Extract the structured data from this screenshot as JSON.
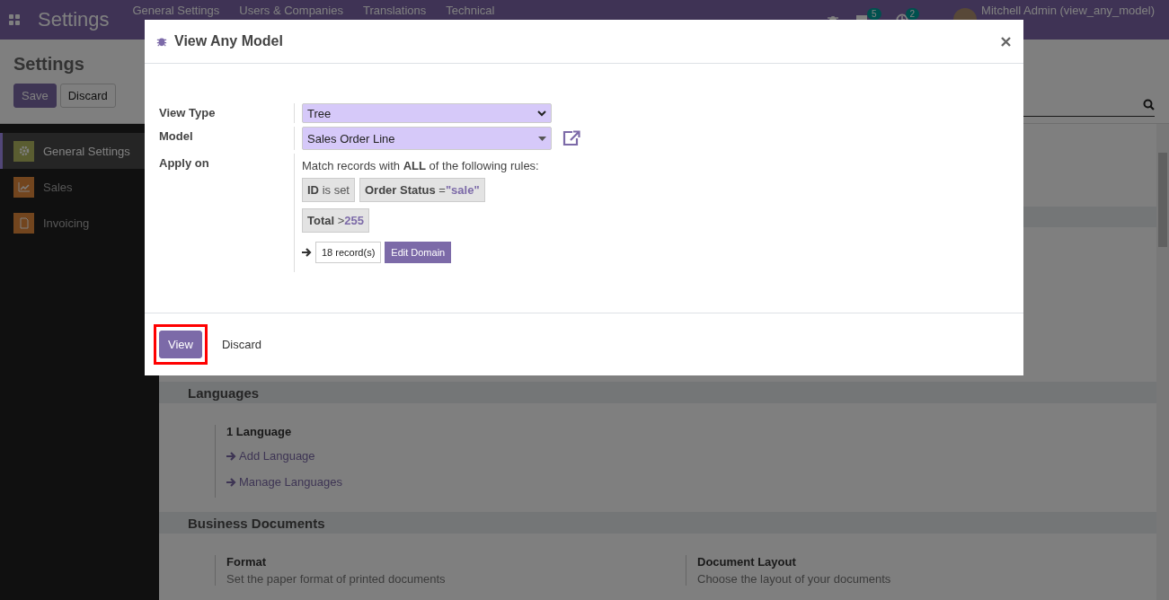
{
  "navbar": {
    "app_title": "Settings",
    "menu": [
      "General Settings",
      "Users & Companies",
      "Translations",
      "Technical"
    ],
    "chat_count": "5",
    "activity_count": "2",
    "user": "Mitchell Admin (view_any_model)"
  },
  "control_panel": {
    "breadcrumb": "Settings",
    "buttons": [
      {
        "label": "Save",
        "kind": "primary"
      },
      {
        "label": "Discard",
        "kind": "secondary"
      }
    ]
  },
  "sidebar": {
    "items": [
      {
        "label": "General Settings",
        "selected": true
      },
      {
        "label": "Sales",
        "selected": false
      },
      {
        "label": "Invoicing",
        "selected": false
      }
    ]
  },
  "sections": [
    {
      "title": "Languages",
      "blocks": [
        {
          "title": "1 Language",
          "links": [
            "Add Language",
            "Manage Languages"
          ]
        }
      ]
    },
    {
      "title": "Business Documents",
      "blocks": [
        {
          "title": "Format",
          "description": "Set the paper format of printed documents"
        },
        {
          "title": "Document Layout",
          "description": "Choose the layout of your documents"
        }
      ]
    }
  ],
  "modal": {
    "title": "View Any Model",
    "fields": [
      {
        "label": "View Type",
        "kind": "select",
        "value": "Tree"
      },
      {
        "label": "Model",
        "kind": "many2one",
        "value": "Sales Order Line"
      },
      {
        "label": "Apply on",
        "kind": "domain",
        "intro": "Match records with **ALL** of the following rules:",
        "rules": [
          {
            "field": "ID",
            "operator": "is set"
          },
          {
            "field": "Order Status",
            "operator": "=",
            "value": "\"sale\""
          },
          {
            "field": "Total",
            "operator": ">",
            "value": "255"
          }
        ],
        "record_count": "18 record(s)",
        "edit_button": "Edit Domain"
      }
    ],
    "footer_buttons": [
      {
        "label": "View",
        "kind": "primary",
        "highlighted": true
      },
      {
        "label": "Discard",
        "kind": "link",
        "highlighted": false
      }
    ]
  }
}
